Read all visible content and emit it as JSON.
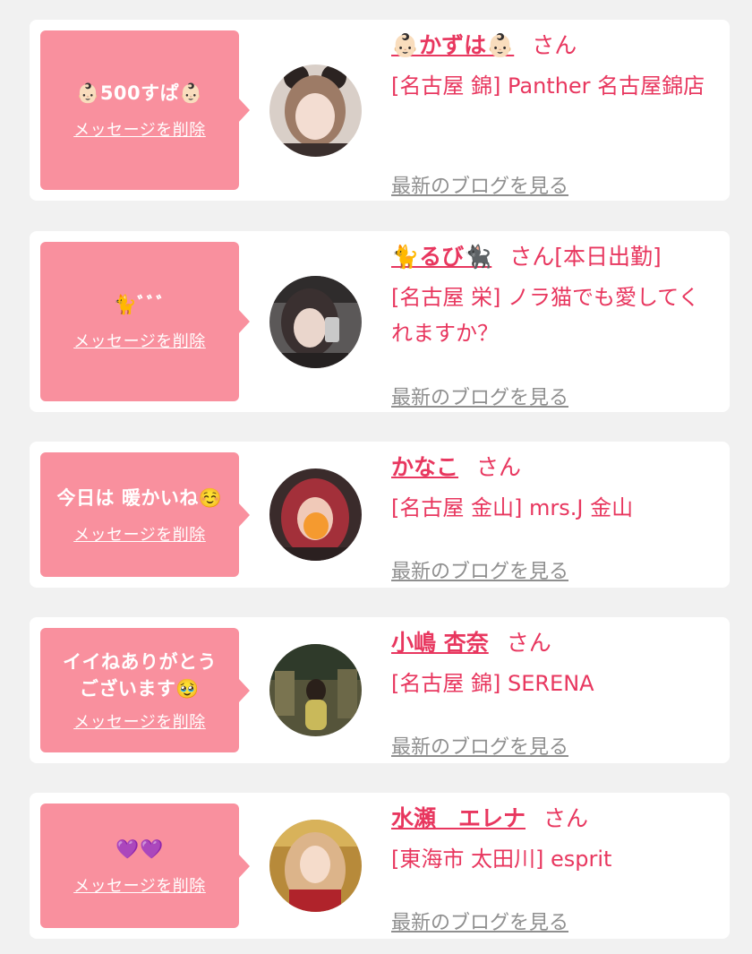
{
  "delete_label": "メッセージを削除",
  "blog_label": "最新のブログを見る",
  "san_label": "さん",
  "colors": {
    "accent": "#e8375f",
    "bubble": "#f9909e",
    "background": "#f1f1f1",
    "muted": "#8f8f8f"
  },
  "cards": [
    {
      "message": "👶🏻500すぱ👶🏻",
      "name": "👶🏻かずは👶🏻",
      "san_suffix": "さん",
      "shop": "[名古屋 錦] Panther 名古屋錦店"
    },
    {
      "message": "🐈ﾞﾞﾞ",
      "name": "🐈るび🐈‍⬛",
      "san_suffix": "さん[本日出勤]",
      "shop": "[名古屋 栄] ノラ猫でも愛してくれますか？"
    },
    {
      "message": "今日は 暖かいね☺️",
      "name": "かなこ",
      "san_suffix": "さん",
      "shop": "[名古屋 金山] mrs.J 金山"
    },
    {
      "message": "イイねありがとうございます🥹",
      "name": "小嶋 杏奈",
      "san_suffix": "さん",
      "shop": "[名古屋 錦] SERENA"
    },
    {
      "message": "💜💜",
      "name": "水瀬　エレナ",
      "san_suffix": "さん",
      "shop": "[東海市 太田川] esprit"
    }
  ]
}
